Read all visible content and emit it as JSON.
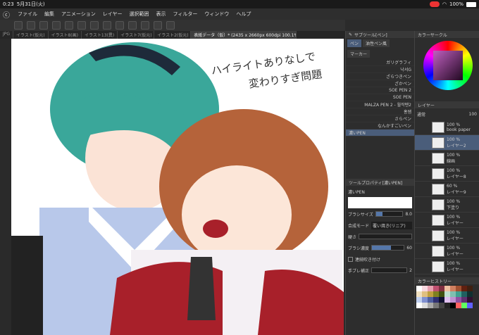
{
  "status": {
    "time": "0:23",
    "date": "5月31日(火)",
    "battery": "100%"
  },
  "menu": [
    "ファイル",
    "編集",
    "アニメーション",
    "レイヤー",
    "選択範囲",
    "表示",
    "フィルター",
    "ウィンドウ",
    "ヘルプ"
  ],
  "tabs": [
    "JPG",
    "イラスト(仮元)",
    "イラスト8(画)",
    "イラスト13(異)",
    "イラスト7(仮元)",
    "イラスト2(仮元)",
    "表紙データ（仮）* (2435 x 2660px 600dpi 100.1%)"
  ],
  "subtool": {
    "title": "サブツール[ペン]",
    "tabs": [
      "ペン",
      "油性ペン風"
    ],
    "group": "マーカー",
    "brushes": [
      "ガリグラフィ",
      "낙서G",
      "ざらつきペン",
      "ざかペン",
      "SOE PEN 2",
      "SOE PEN",
      "MALZA PEN 2 - 월작펜2",
      "홍쌤",
      "さらペン",
      "なんかすごいペン",
      "濃いPEN"
    ]
  },
  "toolprop": {
    "title": "ツールプロパティ[濃いPEN]",
    "name": "濃いPEN",
    "brush_size_label": "ブラシサイズ",
    "brush_size": "8.0",
    "blend_label": "合成モード",
    "blend_value": "覆い焼き(リニア)",
    "hardness_label": "硬さ",
    "density_label": "ブラシ濃度",
    "density": "60",
    "density_pct": 60,
    "size_pct": 25,
    "airbrush_label": "連続吹き付け",
    "stabilizer_label": "手ブレ補正",
    "stabilizer": "2"
  },
  "color": {
    "title": "カラーサークル"
  },
  "layers": {
    "title": "レイヤー",
    "mode": "通常",
    "opacity": "100",
    "items": [
      {
        "a": "100 %",
        "b": "book paper"
      },
      {
        "a": "100 %",
        "b": "レイヤー2"
      },
      {
        "a": "100 %",
        "b": "線画"
      },
      {
        "a": "100 %",
        "b": "レイヤー8"
      },
      {
        "a": "60 %",
        "b": "レイヤー9"
      },
      {
        "a": "100 %",
        "b": "下塗り"
      },
      {
        "a": "100 %",
        "b": "レイヤー"
      },
      {
        "a": "100 %",
        "b": "レイヤー"
      },
      {
        "a": "100 %",
        "b": "レイヤー"
      },
      {
        "a": "100 %",
        "b": "レイヤー"
      }
    ]
  },
  "history": {
    "title": "カラーヒストリー"
  },
  "canvas_text": {
    "line1": "ハイライトありなしで",
    "line2": "変わりすぎ問題"
  },
  "colors": {
    "accent": "#4a5d7a",
    "teal_hair": "#3aa79a",
    "brown_hair": "#b5633a",
    "vest": "#a8202a"
  }
}
